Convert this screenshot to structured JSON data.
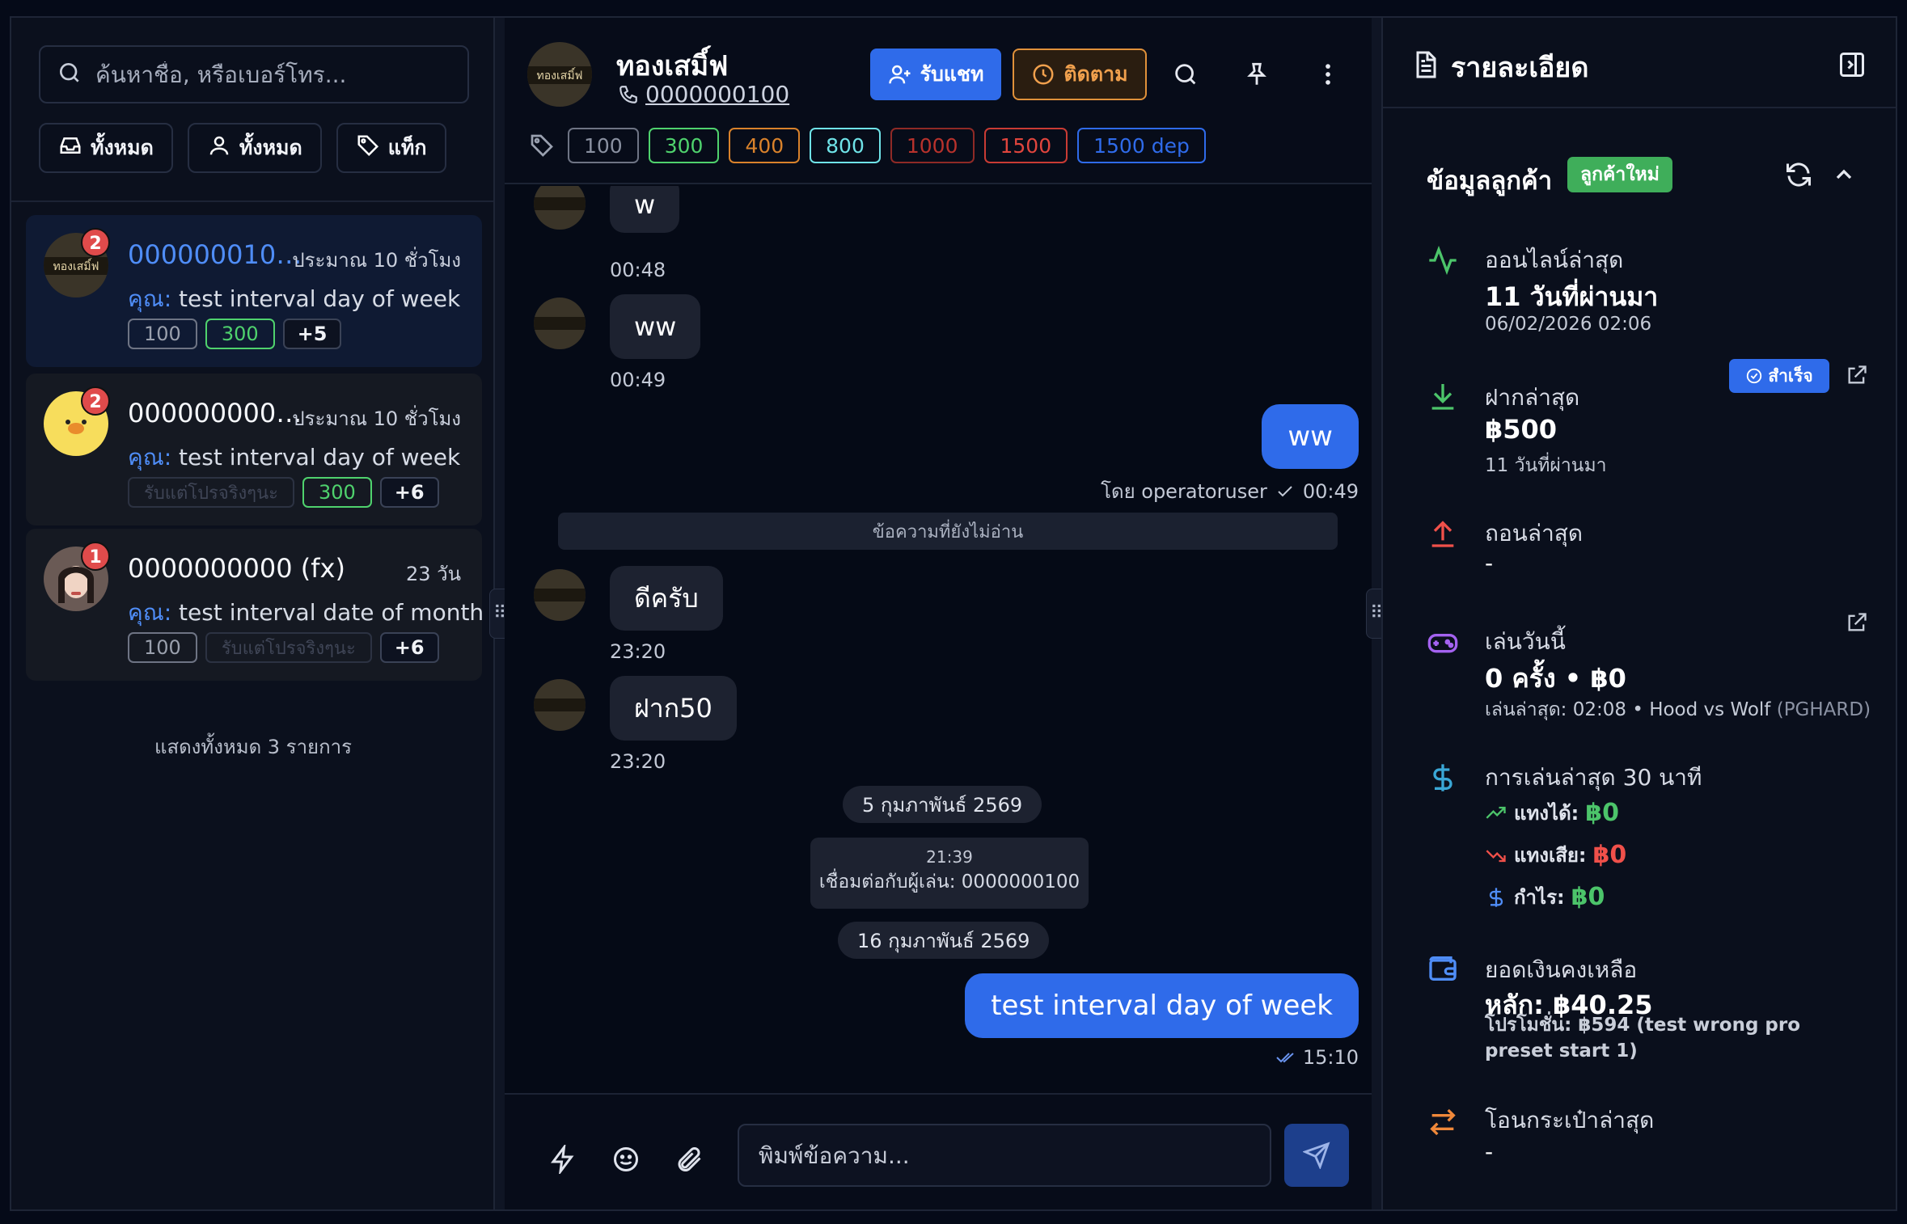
{
  "left": {
    "search_placeholder": "ค้นหาชื่อ, หรือเบอร์โทร...",
    "filters": [
      {
        "label": "ทั้งหมด",
        "icon": "inbox-icon"
      },
      {
        "label": "ทั้งหมด",
        "icon": "user-icon"
      },
      {
        "label": "แท็ก",
        "icon": "tag-icon"
      }
    ],
    "conversations": [
      {
        "name": "0000000100...",
        "time": "ประมาณ 10 ชั่วโมง",
        "badge": "2",
        "you": "คุณ:",
        "msg": "test interval day of week",
        "tags": [
          "100",
          "300"
        ],
        "more": "+5"
      },
      {
        "name": "0000000001...",
        "time": "ประมาณ 10 ชั่วโมง",
        "badge": "2",
        "you": "คุณ:",
        "msg": "test interval day of week",
        "tags": [
          "รับแต่โปรจริงๆนะ",
          "300"
        ],
        "more": "+6"
      },
      {
        "name": "0000000000 (fx)",
        "time": "23 วัน",
        "badge": "1",
        "you": "คุณ:",
        "msg": "test interval date of month",
        "tags": [
          "100",
          "รับแต่โปรจริงๆนะ"
        ],
        "more": "+6"
      }
    ],
    "show_all": "แสดงทั้งหมด 3 รายการ"
  },
  "chat": {
    "name": "ทองเสมิ์ฟ",
    "phone": "0000000100",
    "accept_label": "รับแชท",
    "follow_label": "ติดตาม",
    "tags": [
      {
        "label": "100",
        "color": "#8a91a1"
      },
      {
        "label": "300",
        "color": "#4fd26d"
      },
      {
        "label": "400",
        "color": "#d9822b"
      },
      {
        "label": "800",
        "color": "#6fe3e8"
      },
      {
        "label": "1000",
        "color": "#b8322c"
      },
      {
        "label": "1500",
        "color": "#e0453d"
      },
      {
        "label": "1500 dep",
        "color": "#2f6bea"
      }
    ],
    "messages": {
      "m1": "w",
      "t1": "00:48",
      "m2": "ww",
      "t2": "00:49",
      "m3": "ww",
      "t3_by": "โดย operatoruser",
      "t3": "00:49",
      "unread": "ข้อความที่ยังไม่อ่าน",
      "m4": "ดีครับ",
      "t4": "23:20",
      "m5": "ฝาก50",
      "t5": "23:20",
      "date1": "5 กุมภาพันธ์ 2569",
      "sys_time": "21:39",
      "sys_text": "เชื่อมต่อกับผู้เล่น: 0000000100",
      "date2": "16 กุมภาพันธ์ 2569",
      "m6": "test interval day of week",
      "t6": "15:10"
    },
    "composer_placeholder": "พิมพ์ข้อความ..."
  },
  "details": {
    "title": "รายละเอียด",
    "section": "ข้อมูลลูกค้า",
    "new_badge": "ลูกค้าใหม่",
    "last_online_label": "ออนไลน์ล่าสุด",
    "last_online_big": "11 วันที่ผ่านมา",
    "last_online_sub": "06/02/2026 02:06",
    "deposit_label": "ฝากล่าสุด",
    "deposit_status": "สำเร็จ",
    "deposit_big": "฿500",
    "deposit_sub": "11 วันที่ผ่านมา",
    "withdraw_label": "ถอนล่าสุด",
    "withdraw_val": "-",
    "play_label": "เล่นวันนี้",
    "play_big": "0 ครั้ง • ฿0",
    "play_sub": "เล่นล่าสุด: 02:08 • Hood vs Wolf",
    "play_sub_code": "(PGHARD)",
    "recent_label": "การเล่นล่าสุด 30 นาที",
    "win_label": "แทงได้:",
    "win_val": "฿0",
    "lose_label": "แทงเสีย:",
    "lose_val": "฿0",
    "profit_label": "กำไร:",
    "profit_val": "฿0",
    "balance_label": "ยอดเงินคงเหลือ",
    "balance_big": "หลัก: ฿40.25",
    "promo": "โปรโมชั่น: ฿594 (test wrong pro preset start 1)",
    "transfer_label": "โอนกระเป๋าล่าสุด",
    "transfer_val": "-"
  },
  "colors": {
    "accent": "#2f6bea",
    "success": "#3fae5a",
    "danger": "#e04b4b",
    "warning": "#e0913a"
  }
}
